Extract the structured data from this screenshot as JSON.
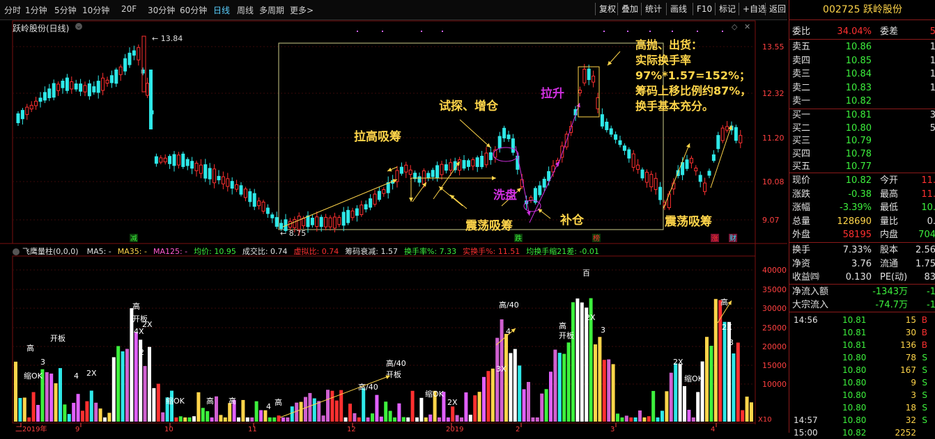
{
  "toolbar": {
    "periods": [
      "分时",
      "1分钟",
      "5分钟",
      "10分钟",
      "20F",
      "30分钟",
      "60分钟",
      "日线",
      "周线",
      "多周期",
      "更多>"
    ],
    "active": "日线",
    "right_buttons": [
      "复权",
      "叠加",
      "统计",
      "画线",
      "F10",
      "标记",
      "+自选",
      "返回"
    ]
  },
  "chart": {
    "stock_label": "跃岭股份(日线)",
    "price_axis": [
      "13.55",
      "12.32",
      "11.20",
      "10.08",
      "9.07"
    ],
    "high_label": "13.84",
    "low_label": "8.75",
    "markers": [
      "减",
      "跌",
      "榜",
      "涨",
      "财"
    ],
    "annotations": {
      "pull_up_absorb": "拉高吸筹",
      "probe_add": "试探、增仓",
      "wash": "洗盘",
      "oscillate_absorb_1": "震荡吸筹",
      "refill": "补仓",
      "lift": "拉升",
      "oscillate_absorb_2": "震荡吸筹",
      "distribute_lines": [
        "高抛、出货：",
        "实际换手率",
        "97%*1.57=152%；",
        "筹码上移比例约87%，",
        "换手基本充分。"
      ]
    }
  },
  "indicator": {
    "name": "飞鹰量柱(0,0,0)",
    "fields": [
      {
        "label": "MA5: -",
        "color": "#e0e0e0"
      },
      {
        "label": "MA35: -",
        "color": "#ffd54a"
      },
      {
        "label": "MA125: -",
        "color": "#ff5ad0"
      },
      {
        "label": "均价: 10.95",
        "color": "#3df03d"
      },
      {
        "label": "成交比: 0.74",
        "color": "#e0e0e0"
      },
      {
        "label": "虚拟比: 0.74",
        "color": "#ff3030"
      },
      {
        "label": "筹码衰减: 1.57",
        "color": "#e0e0e0"
      },
      {
        "label": "换手率%: 7.33",
        "color": "#3df03d"
      },
      {
        "label": "实换手%: 11.51",
        "color": "#ff3030"
      },
      {
        "label": "均换手缩21差: -0.01",
        "color": "#3df03d"
      }
    ],
    "vol_axis": [
      "40000",
      "35000",
      "30000",
      "25000",
      "20000",
      "15000",
      "10000"
    ],
    "scale": "X10",
    "x_labels": [
      "二2019年",
      "9",
      "10",
      "11",
      "12",
      "2019",
      "2",
      "3",
      "4"
    ],
    "bar_labels": [
      "高",
      "开板",
      "缩OK",
      "3",
      "4",
      "2X",
      "高",
      "开板",
      "4X",
      "2X",
      "2",
      "缩OK",
      "高",
      "高",
      "4",
      "高",
      "高/40",
      "开板",
      "高/40",
      "缩OK",
      "2X",
      "高/40",
      "4",
      "3X",
      "百",
      "2X",
      "高",
      "开板",
      "3",
      "2X",
      "缩OK",
      "高",
      "2X",
      "3"
    ]
  },
  "panel": {
    "title": "002725 跃岭股份",
    "weibi": {
      "label": "委比",
      "value": "34.04%",
      "label2": "委差",
      "value2": "5"
    },
    "asks": [
      {
        "label": "卖五",
        "price": "10.86",
        "vol": "1"
      },
      {
        "label": "卖四",
        "price": "10.85",
        "vol": "1"
      },
      {
        "label": "卖三",
        "price": "10.84",
        "vol": "1"
      },
      {
        "label": "卖二",
        "price": "10.83",
        "vol": "1"
      },
      {
        "label": "卖一",
        "price": "10.82",
        "vol": ""
      }
    ],
    "bids": [
      {
        "label": "买一",
        "price": "10.81",
        "vol": "3"
      },
      {
        "label": "买二",
        "price": "10.80",
        "vol": "5"
      },
      {
        "label": "买三",
        "price": "10.79",
        "vol": ""
      },
      {
        "label": "买四",
        "price": "10.78",
        "vol": ""
      },
      {
        "label": "买五",
        "price": "10.77",
        "vol": ""
      }
    ],
    "quote": [
      {
        "l": "现价",
        "v": "10.82",
        "vc": "#3df03d",
        "l2": "今开",
        "v2": "11.",
        "v2c": "#ff3030"
      },
      {
        "l": "涨跌",
        "v": "-0.38",
        "vc": "#3df03d",
        "l2": "最高",
        "v2": "11.",
        "v2c": "#ff3030"
      },
      {
        "l": "涨幅",
        "v": "-3.39%",
        "vc": "#3df03d",
        "l2": "最低",
        "v2": "10.",
        "v2c": "#3df03d"
      },
      {
        "l": "总量",
        "v": "128690",
        "vc": "#ffd54a",
        "l2": "量比",
        "v2": "0.",
        "v2c": "#e0e0e0"
      },
      {
        "l": "外盘",
        "v": "58195",
        "vc": "#ff3030",
        "l2": "内盘",
        "v2": "704",
        "v2c": "#3df03d"
      }
    ],
    "fin": [
      {
        "l": "换手",
        "v": "7.33%",
        "vc": "#e0e0e0",
        "l2": "股本",
        "v2": "2.56",
        "v2c": "#e0e0e0"
      },
      {
        "l": "净资",
        "v": "3.76",
        "vc": "#e0e0e0",
        "l2": "流通",
        "v2": "1.75",
        "v2c": "#e0e0e0"
      },
      {
        "l": "收益㈣",
        "v": "0.130",
        "vc": "#e0e0e0",
        "l2": "PE(动)",
        "v2": "83",
        "v2c": "#e0e0e0"
      }
    ],
    "flow": [
      {
        "l": "净流入额",
        "v": "-1343万",
        "v2": "-1"
      },
      {
        "l": "大宗流入",
        "v": "-74.7万",
        "v2": "-1"
      }
    ],
    "ticks": [
      {
        "t": "14:56",
        "p": "10.81",
        "v": "15",
        "f": "B"
      },
      {
        "t": "",
        "p": "10.81",
        "v": "30",
        "f": "B"
      },
      {
        "t": "",
        "p": "10.81",
        "v": "136",
        "f": "B"
      },
      {
        "t": "",
        "p": "10.80",
        "v": "78",
        "f": "S"
      },
      {
        "t": "",
        "p": "10.80",
        "v": "167",
        "f": "S"
      },
      {
        "t": "",
        "p": "10.80",
        "v": "9",
        "f": "S"
      },
      {
        "t": "",
        "p": "10.80",
        "v": "3",
        "f": "S"
      },
      {
        "t": "",
        "p": "10.80",
        "v": "18",
        "f": "S"
      },
      {
        "t": "14:57",
        "p": "10.80",
        "v": "32",
        "f": "S"
      },
      {
        "t": "15:00",
        "p": "10.82",
        "v": "2252",
        "f": ""
      }
    ]
  }
}
